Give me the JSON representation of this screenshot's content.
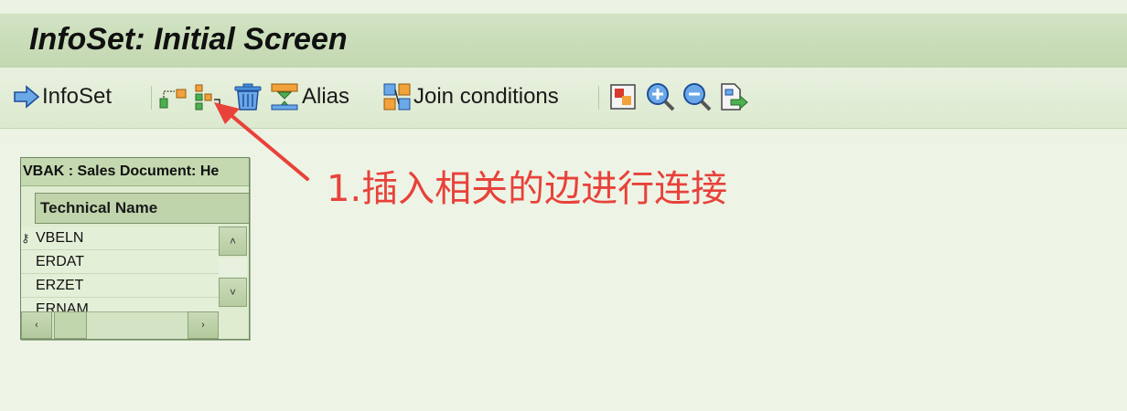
{
  "window": {
    "title": "InfoSet: Initial Screen"
  },
  "toolbar": {
    "infoset_label": "InfoSet",
    "alias_label": "Alias",
    "join_label": "Join conditions",
    "icons": [
      "arrow-right-icon",
      "insert-table-icon",
      "insert-join-icon",
      "delete-icon",
      "alias-icon",
      "join-conditions-icon",
      "color-icon",
      "zoom-in-icon",
      "zoom-out-icon",
      "export-icon"
    ]
  },
  "table_widget": {
    "title": "VBAK : Sales Document: He",
    "column_header": "Technical Name",
    "rows": [
      "VBELN",
      "ERDAT",
      "ERZET",
      "ERNAM"
    ],
    "scroll_up": "˄",
    "scroll_down": "˅",
    "scroll_left": "‹",
    "scroll_right": "›"
  },
  "annotation": {
    "text": "1.插入相关的边进行连接",
    "color": "#e8423a"
  },
  "colors": {
    "title_bar": "#c8ddb6",
    "background": "#ecf3e4",
    "accent": "#1f6fc5"
  }
}
